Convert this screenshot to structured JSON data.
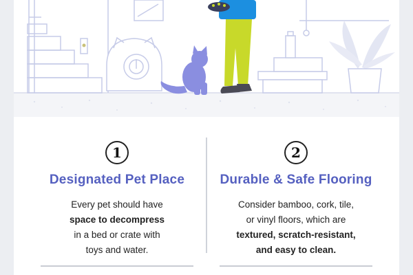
{
  "steps": [
    {
      "number": "1",
      "title": "Designated Pet Place",
      "lines": [
        {
          "pre": "Every pet should have",
          "bold": "",
          "post": ""
        },
        {
          "pre": "",
          "bold": "space to decompress",
          "post": ""
        },
        {
          "pre": "in a bed or crate with",
          "bold": "",
          "post": ""
        },
        {
          "pre": "toys and water.",
          "bold": "",
          "post": ""
        }
      ]
    },
    {
      "number": "2",
      "title": "Durable & Safe Flooring",
      "lines": [
        {
          "pre": "Consider bamboo, cork, tile,",
          "bold": "",
          "post": ""
        },
        {
          "pre": "or vinyl floors, which are",
          "bold": "",
          "post": ""
        },
        {
          "pre": "",
          "bold": "textured, scratch-resistant,",
          "post": ""
        },
        {
          "pre": "",
          "bold": "and easy to clean.",
          "post": ""
        }
      ]
    }
  ],
  "colors": {
    "title": "#5560c0",
    "cat": "#8a8ee0",
    "pants": "#c8d92a",
    "shirt": "#1c8fe0",
    "outline": "#c6cbe8"
  }
}
